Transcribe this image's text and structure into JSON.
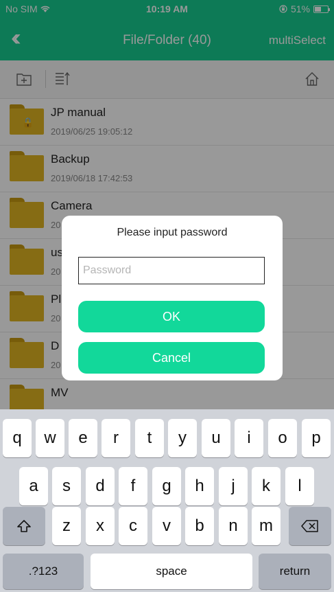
{
  "status_bar": {
    "carrier": "No SIM",
    "time": "10:19 AM",
    "battery_text": "51%",
    "battery_level": 0.51
  },
  "nav": {
    "title": "File/Folder (40)",
    "multiselect": "multiSelect"
  },
  "files": [
    {
      "name": "JP manual",
      "date": "2019/06/25 19:05:12",
      "locked": true
    },
    {
      "name": "Backup",
      "date": "2019/06/18 17:42:53",
      "locked": false
    },
    {
      "name": "Camera",
      "date": "20",
      "locked": false
    },
    {
      "name": "us",
      "date": "20",
      "locked": false
    },
    {
      "name": "Pl",
      "date": "20",
      "locked": false
    },
    {
      "name": "D",
      "date": "20",
      "locked": false
    },
    {
      "name": "MV",
      "date": "",
      "locked": false
    }
  ],
  "dialog": {
    "title": "Please input password",
    "input_placeholder": "Password",
    "input_value": "",
    "ok_label": "OK",
    "cancel_label": "Cancel"
  },
  "keyboard": {
    "row1": [
      "q",
      "w",
      "e",
      "r",
      "t",
      "y",
      "u",
      "i",
      "o",
      "p"
    ],
    "row2": [
      "a",
      "s",
      "d",
      "f",
      "g",
      "h",
      "j",
      "k",
      "l"
    ],
    "row3": [
      "z",
      "x",
      "c",
      "v",
      "b",
      "n",
      "m"
    ],
    "numbers_label": ".?123",
    "space_label": "space",
    "return_label": "return"
  }
}
